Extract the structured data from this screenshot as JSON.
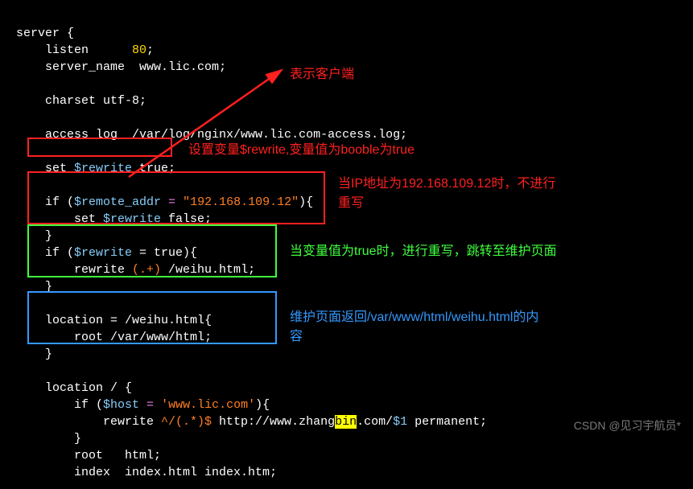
{
  "code": {
    "l1": "server {",
    "l2a": "    listen      ",
    "l2b": "80",
    "l2c": ";",
    "l3a": "    server_name  ",
    "l3b": "www.lic.com",
    "l3c": ";",
    "l4": "",
    "l5a": "    charset ",
    "l5b": "utf-8",
    "l5c": ";",
    "l6": "",
    "l7a": "    access_log  ",
    "l7b": "/var/log/nginx/www.lic.com-access.log",
    "l7c": ";",
    "l8": "",
    "l9a": "    set ",
    "l9b": "$rewrite",
    "l9c": " true;",
    "l10": "",
    "l11a": "    if (",
    "l11b": "$remote_addr",
    "l11c": " = ",
    "l11d": "\"192.168.109.12\"",
    "l11e": "){",
    "l12a": "        set ",
    "l12b": "$rewrite",
    "l12c": " false;",
    "l13": "    }",
    "l14a": "    if (",
    "l14b": "$rewrite",
    "l14c": " = true){",
    "l15a": "        rewrite ",
    "l15b": "(.+)",
    "l15c": " /weihu.html;",
    "l16": "    }",
    "l17": "",
    "l18a": "    location = ",
    "l18b": "/weihu.html",
    "l18c": "{",
    "l19a": "        root ",
    "l19b": "/var/www/html",
    "l19c": ";",
    "l20": "    }",
    "l21": "",
    "l22a": "    location / {",
    "l23a": "        if (",
    "l23b": "$host",
    "l23c": " = ",
    "l23d": "'www.lic.com'",
    "l23e": "){",
    "l24a": "            rewrite ",
    "l24b": "^/(.*)$",
    "l24c": " http://www.zhang",
    "l24d": "bin",
    "l24e": ".com/",
    "l24f": "$1",
    "l24g": " permanent;",
    "l25": "        }",
    "l26a": "        root   ",
    "l26b": "html",
    "l26c": ";",
    "l27a": "        index  ",
    "l27b": "index.html index.htm",
    "l27c": ";"
  },
  "annotations": {
    "an1": "表示客户端",
    "an2": "设置变量$rewrite,变量值为booble为true",
    "an3a": "当IP地址为192.168.109.12时，不进行",
    "an3b": "重写",
    "an4": "当变量值为true时，进行重写，跳转至维护页面",
    "an5a": "维护页面返回/var/www/html/weihu.html的内",
    "an5b": "容"
  },
  "watermark": "CSDN @见习宇航员*"
}
